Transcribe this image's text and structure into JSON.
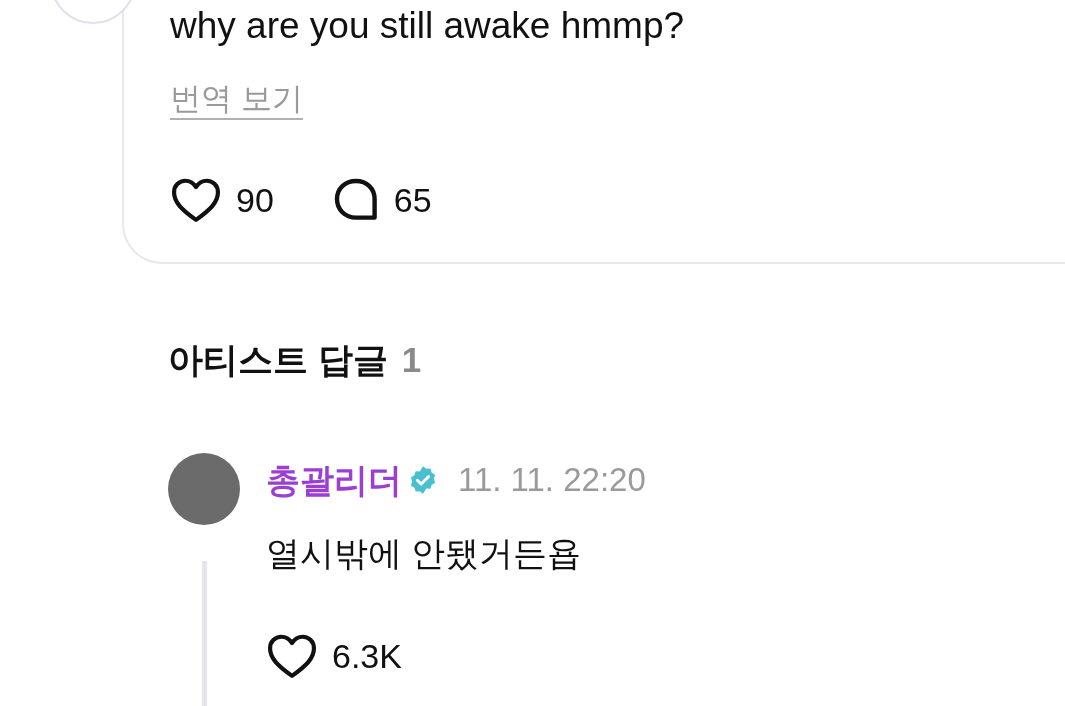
{
  "post": {
    "text": "why are you still awake hmmp?",
    "translate": "번역 보기",
    "likes": "90",
    "comments": "65"
  },
  "artist_replies": {
    "title": "아티스트 답글",
    "count": "1",
    "replies": [
      {
        "name": "총괄리더",
        "verified": true,
        "time": "11. 11. 22:20",
        "text": "열시밖에 안됐거든욥",
        "likes": "6.3K"
      }
    ]
  }
}
